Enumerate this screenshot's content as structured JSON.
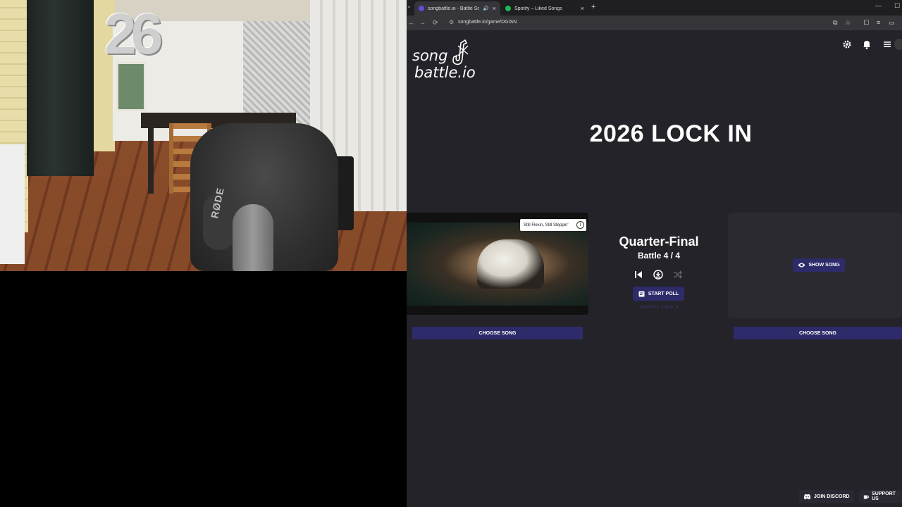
{
  "webcam": {
    "balloon_number": "26",
    "mic_brand": "RØDE"
  },
  "browser": {
    "tabs": [
      {
        "title": "songbattle.io - Battle Songs",
        "active": true
      },
      {
        "title": "Spotify – Liked Songs",
        "active": false
      }
    ],
    "url": "songbattle.io/game/DGISN"
  },
  "page": {
    "logo_line1": "song",
    "logo_line2": "battle.io",
    "game_title": "2026 LOCK IN",
    "left_song": {
      "tooltip": "Still Flexin, Still Steppin'",
      "choose_label": "CHOOSE SONG"
    },
    "center": {
      "round": "Quarter-Final",
      "battle": "Battle 4 / 4",
      "start_poll": "START POLL",
      "length": "LENGTH: 1 MIN. ▾"
    },
    "right_song": {
      "show_label": "SHOW SONG",
      "choose_label": "CHOOSE SONG"
    },
    "footer": {
      "discord": "JOIN DISCORD",
      "support": "SUPPORT US"
    }
  },
  "colors": {
    "page_bg": "#242329",
    "accent": "#2e2b6b",
    "card_bg": "#2b2a30"
  }
}
